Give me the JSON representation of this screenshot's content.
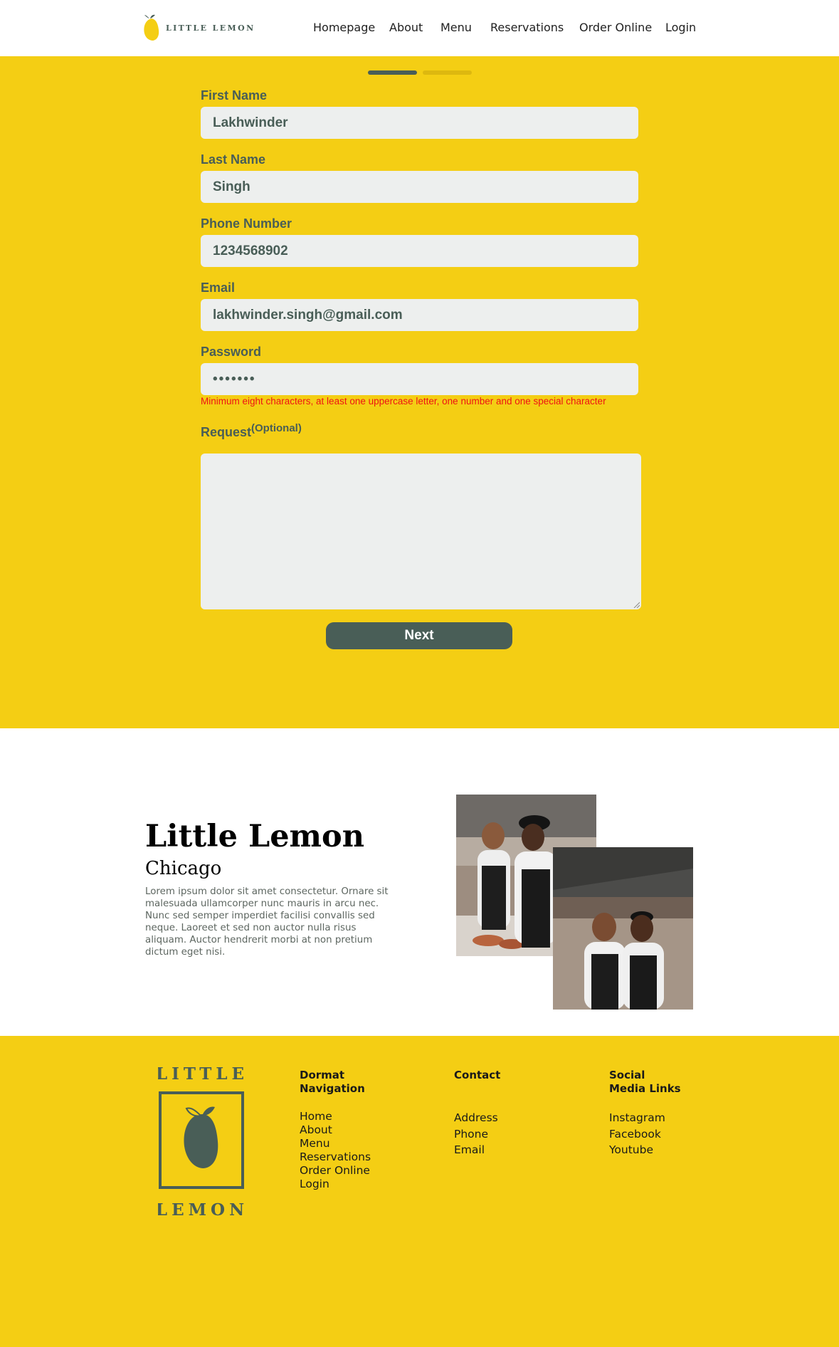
{
  "header": {
    "logo_text": "LITTLE LEMON",
    "nav": [
      "Homepage",
      "About",
      "Menu",
      "Reservations",
      "Order Online",
      "Login"
    ]
  },
  "form": {
    "progress": {
      "current_step": 1,
      "total_steps": 2
    },
    "fields": [
      {
        "label": "First Name",
        "value": "Lakhwinder"
      },
      {
        "label": "Last Name",
        "value": "Singh"
      },
      {
        "label": "Phone Number",
        "value": "1234568902"
      },
      {
        "label": "Email",
        "value": "lakhwinder.singh@gmail.com"
      },
      {
        "label": "Password",
        "value": "•••••••"
      }
    ],
    "password_hint": "Minimum eight characters, at least one uppercase letter, one number and one special character",
    "request_label": "Request",
    "request_optional": "(Optional)",
    "request_value": "",
    "next_label": "Next"
  },
  "about": {
    "title": "Little Lemon",
    "subtitle": "Chicago",
    "body": "Lorem ipsum dolor sit amet consectetur. Ornare sit malesuada ullamcorper nunc mauris in arcu nec. Nunc sed semper imperdiet facilisi convallis sed neque. Laoreet et sed non auctor nulla risus aliquam. Auctor hendrerit morbi at non pretium dictum eget nisi."
  },
  "footer": {
    "logo_top": "LITTLE",
    "logo_bottom": "LEMON",
    "columns": [
      {
        "heading_line1": "Dormat",
        "heading_line2": "Navigation",
        "items": [
          "Home",
          "About",
          "Menu",
          "Reservations",
          "Order Online",
          "Login"
        ]
      },
      {
        "heading_line1": "Contact",
        "heading_line2": "",
        "items": [
          "Address",
          "Phone",
          "Email"
        ]
      },
      {
        "heading_line1": "Social",
        "heading_line2": "Media Links",
        "items": [
          "Instagram",
          "Facebook",
          "Youtube"
        ]
      }
    ]
  },
  "colors": {
    "primary_yellow": "#f4ce14",
    "primary_green": "#495e57",
    "field_bg": "#edefee",
    "error_red": "#ee1414"
  },
  "icons": [
    "lemon-logo-icon",
    "resize-grip-icon"
  ]
}
